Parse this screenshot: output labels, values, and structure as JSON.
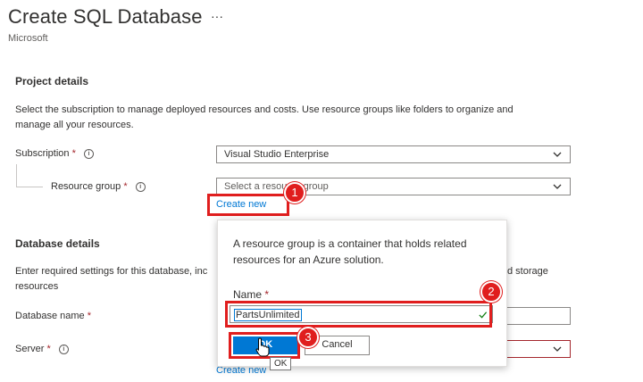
{
  "header": {
    "title": "Create SQL Database",
    "more_label": "···",
    "subtitle": "Microsoft"
  },
  "project": {
    "heading": "Project details",
    "description_line1": "Select the subscription to manage deployed resources and costs. Use resource groups like folders to organize and",
    "description_line2": "manage all your resources.",
    "subscription_label": "Subscription",
    "subscription_value": "Visual Studio Enterprise",
    "resource_group_label": "Resource group",
    "resource_group_placeholder": "Select a resource group",
    "create_new_label": "Create new"
  },
  "database": {
    "heading": "Database details",
    "description_line1_left": "Enter required settings for this database, inc",
    "description_line1_right": "d storage",
    "description_line2": "resources",
    "database_name_label": "Database name",
    "server_label": "Server",
    "server_create_new_fragment": "Create new"
  },
  "required_marker": "*",
  "info_glyph": "i",
  "popup": {
    "description_line1": "A resource group is a container that holds related",
    "description_line2": "resources for an Azure solution.",
    "name_label": "Name",
    "name_value": "PartsUnlimited",
    "ok_label": "OK",
    "cancel_label": "Cancel"
  },
  "tooltip": {
    "text": "OK"
  },
  "callouts": {
    "one": "1",
    "two": "2",
    "three": "3"
  },
  "colors": {
    "link": "#0078d4",
    "primary_button": "#0078d4",
    "callout_red": "#e01e1e",
    "required_red": "#a4262c",
    "valid_green": "#107c10"
  },
  "icons": {
    "more": "ellipsis-icon",
    "info": "info-icon",
    "dropdown": "chevron-down-icon",
    "valid": "checkmark-icon",
    "cursor": "hand-cursor-icon"
  }
}
